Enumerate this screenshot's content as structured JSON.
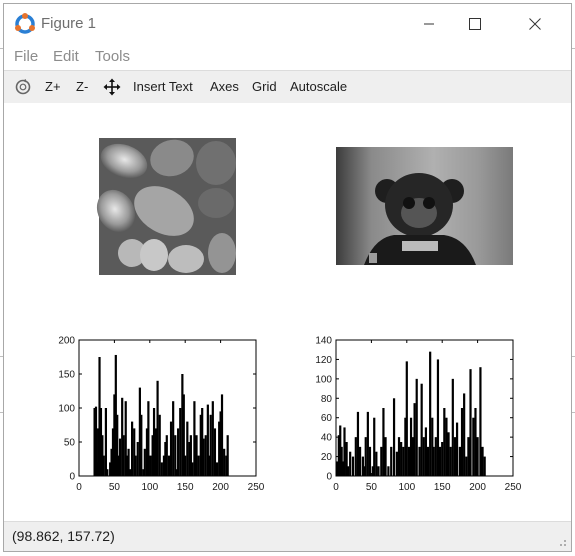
{
  "window": {
    "title": "Figure 1",
    "minimize_icon": "minimize-icon",
    "maximize_icon": "maximize-icon",
    "close_icon": "close-icon"
  },
  "menu": [
    {
      "label": "File"
    },
    {
      "label": "Edit"
    },
    {
      "label": "Tools"
    }
  ],
  "toolbar": {
    "rotate_icon": "rotate-icon",
    "zoom_in": "Z+",
    "zoom_out": "Z-",
    "pan_icon": "pan-arrows-icon",
    "insert_text": "Insert Text",
    "axes": "Axes",
    "grid": "Grid",
    "autoscale": "Autoscale"
  },
  "images": [
    {
      "subject": "peppers-grayscale-image"
    },
    {
      "subject": "robot-toy-grayscale-image"
    }
  ],
  "status": {
    "coordinates": "(98.862, 157.72)"
  },
  "chart_data": [
    {
      "type": "bar",
      "title": "",
      "xlabel": "",
      "ylabel": "",
      "xlim": [
        0,
        250
      ],
      "ylim": [
        0,
        200
      ],
      "x_ticks": [
        0,
        50,
        100,
        150,
        200,
        250
      ],
      "y_ticks": [
        0,
        50,
        100,
        150,
        200
      ],
      "color": "#000000",
      "series": [
        {
          "x": [
            22,
            24,
            26,
            27,
            29,
            31,
            33,
            35,
            38,
            40,
            44,
            46,
            48,
            50,
            52,
            54,
            56,
            58,
            61,
            63,
            66,
            68,
            70,
            72,
            75,
            78,
            80,
            83,
            86,
            88,
            91,
            93,
            96,
            98,
            101,
            104,
            106,
            108,
            111,
            114,
            117,
            120,
            122,
            124,
            127,
            130,
            133,
            136,
            138,
            140,
            143,
            146,
            148,
            150,
            153,
            156,
            158,
            160,
            163,
            166,
            169,
            172,
            174,
            176,
            179,
            182,
            184,
            186,
            189,
            192,
            195,
            198,
            200,
            202,
            205,
            208,
            210
          ],
          "values": [
            100,
            102,
            20,
            70,
            175,
            100,
            60,
            30,
            100,
            10,
            20,
            40,
            70,
            120,
            178,
            90,
            30,
            55,
            115,
            60,
            110,
            30,
            40,
            10,
            80,
            70,
            30,
            50,
            130,
            90,
            10,
            40,
            70,
            110,
            30,
            60,
            100,
            70,
            140,
            90,
            20,
            30,
            50,
            60,
            30,
            80,
            110,
            60,
            10,
            70,
            100,
            150,
            120,
            30,
            80,
            50,
            60,
            20,
            110,
            60,
            30,
            90,
            100,
            55,
            60,
            105,
            30,
            90,
            110,
            70,
            20,
            80,
            95,
            120,
            40,
            30,
            60
          ]
        }
      ]
    },
    {
      "type": "bar",
      "title": "",
      "xlabel": "",
      "ylabel": "",
      "xlim": [
        0,
        250
      ],
      "ylim": [
        0,
        140
      ],
      "x_ticks": [
        0,
        50,
        100,
        150,
        200,
        250
      ],
      "y_ticks": [
        0,
        20,
        40,
        60,
        80,
        100,
        120,
        140
      ],
      "color": "#000000",
      "series": [
        {
          "x": [
            2,
            4,
            6,
            8,
            10,
            12,
            15,
            17,
            20,
            24,
            28,
            31,
            34,
            38,
            40,
            42,
            45,
            48,
            52,
            54,
            57,
            60,
            64,
            67,
            70,
            74,
            78,
            82,
            86,
            89,
            92,
            95,
            98,
            100,
            103,
            106,
            108,
            111,
            114,
            118,
            121,
            124,
            127,
            130,
            133,
            136,
            138,
            141,
            144,
            147,
            150,
            153,
            156,
            159,
            162,
            165,
            168,
            171,
            175,
            178,
            181,
            184,
            187,
            190,
            194,
            197,
            200,
            204,
            207,
            210
          ],
          "values": [
            15,
            42,
            52,
            30,
            15,
            50,
            35,
            10,
            25,
            20,
            40,
            66,
            30,
            20,
            10,
            40,
            66,
            30,
            10,
            60,
            25,
            10,
            30,
            70,
            40,
            10,
            30,
            80,
            25,
            40,
            35,
            30,
            60,
            118,
            30,
            60,
            40,
            75,
            100,
            30,
            95,
            40,
            50,
            30,
            128,
            60,
            30,
            40,
            120,
            30,
            35,
            70,
            60,
            45,
            30,
            100,
            40,
            55,
            30,
            70,
            85,
            20,
            40,
            110,
            60,
            70,
            40,
            112,
            30,
            20
          ]
        }
      ]
    }
  ]
}
